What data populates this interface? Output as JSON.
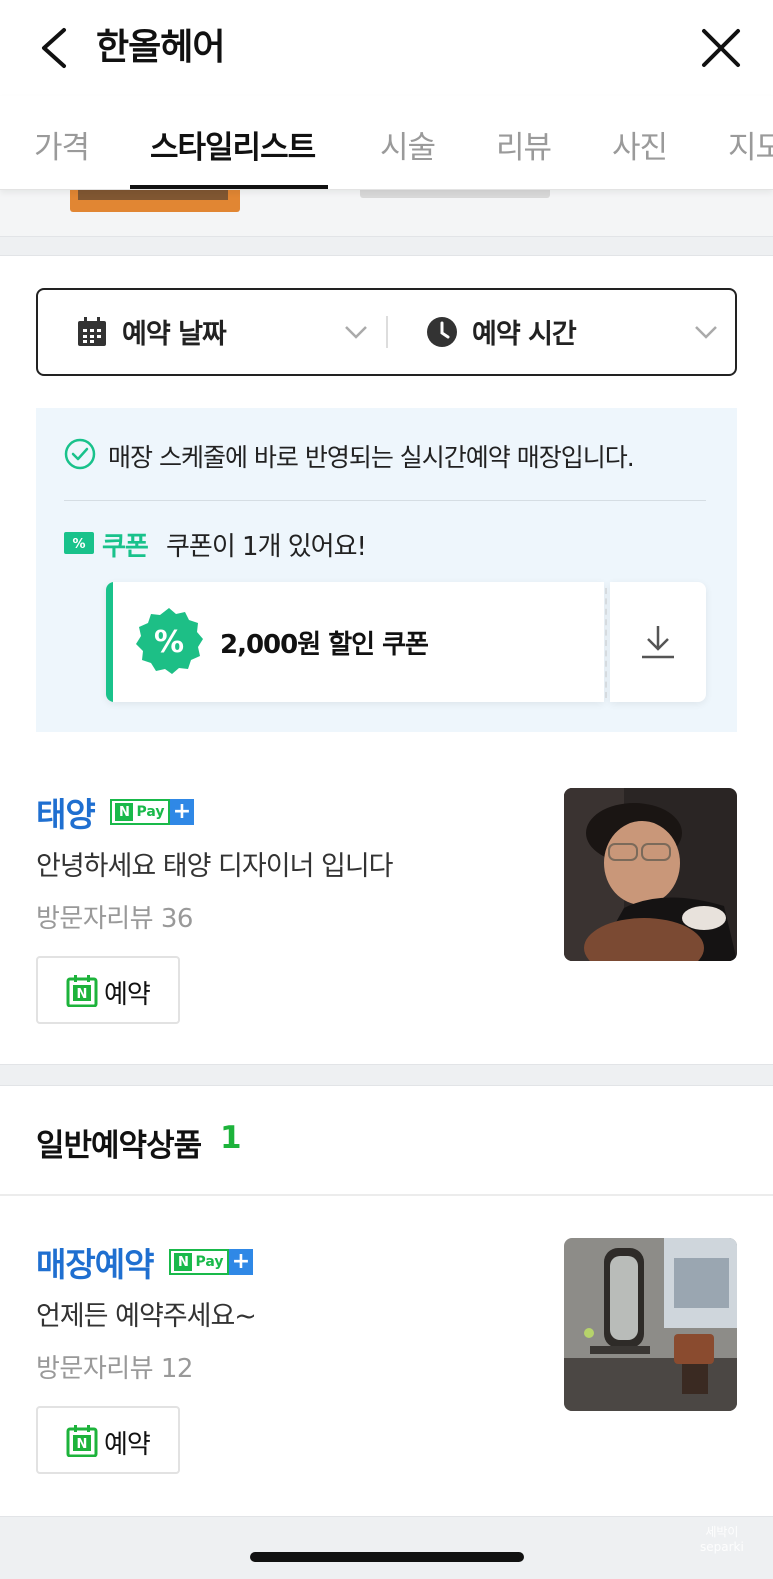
{
  "header": {
    "title": "한올헤어"
  },
  "tabs": [
    "가격",
    "스타일리스트",
    "시술",
    "리뷰",
    "사진",
    "지도"
  ],
  "picker": {
    "date_label": "예약 날짜",
    "time_label": "예약 시간"
  },
  "info": {
    "realtime_text": "매장 스케줄에 바로 반영되는 실시간예약 매장입니다.",
    "coupon_label": "쿠폰",
    "coupon_message": "쿠폰이 1개 있어요!",
    "coupon_title": "2,000원 할인 쿠폰"
  },
  "stylist": {
    "name": "태양",
    "description": "안녕하세요 태양 디자이너 입니다",
    "review": "방문자리뷰 36",
    "button": "예약"
  },
  "section": {
    "title": "일반예약상품",
    "count": "1"
  },
  "product": {
    "name": "매장예약",
    "description": "언제든 예약주세요~",
    "review": "방문자리뷰 12",
    "button": "예약"
  },
  "npay": {
    "n": "N",
    "pay": "Pay",
    "plus": "+"
  },
  "watermark": {
    "line1": "세박이",
    "line2": "separki"
  },
  "colors": {
    "accent_green": "#19c28b",
    "link_blue": "#1f6fd0",
    "npay_green": "#19b94a"
  }
}
